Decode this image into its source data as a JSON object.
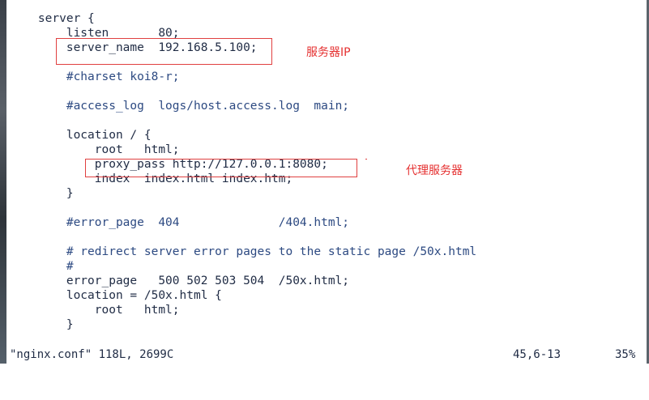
{
  "editor": {
    "lines": [
      {
        "text": "    server {",
        "comment": false
      },
      {
        "text": "        listen       80;",
        "comment": false
      },
      {
        "text": "        server_name  192.168.5.100;",
        "comment": false
      },
      {
        "text": "",
        "comment": false
      },
      {
        "text": "        #charset koi8-r;",
        "comment": true
      },
      {
        "text": "",
        "comment": false
      },
      {
        "text": "        #access_log  logs/host.access.log  main;",
        "comment": true
      },
      {
        "text": "",
        "comment": false
      },
      {
        "text": "        location / {",
        "comment": false
      },
      {
        "text": "            root   html;",
        "comment": false
      },
      {
        "text": "            proxy_pass http://127.0.0.1:8080;",
        "comment": false
      },
      {
        "text": "            index  index.html index.htm;",
        "comment": false
      },
      {
        "text": "        }",
        "comment": false
      },
      {
        "text": "",
        "comment": false
      },
      {
        "text": "        #error_page  404              /404.html;",
        "comment": true
      },
      {
        "text": "",
        "comment": false
      },
      {
        "text": "        # redirect server error pages to the static page /50x.html",
        "comment": true
      },
      {
        "text": "        #",
        "comment": true
      },
      {
        "text": "        error_page   500 502 503 504  /50x.html;",
        "comment": false
      },
      {
        "text": "        location = /50x.html {",
        "comment": false
      },
      {
        "text": "            root   html;",
        "comment": false
      },
      {
        "text": "        }",
        "comment": false
      }
    ]
  },
  "annotations": {
    "server_ip_label": "服务器IP",
    "proxy_server_label": "代理服务器",
    "color": "#e53030"
  },
  "statusbar": {
    "file_info": "\"nginx.conf\" 118L, 2699C",
    "cursor_position": "45,6-13",
    "scroll_percent": "35%"
  }
}
